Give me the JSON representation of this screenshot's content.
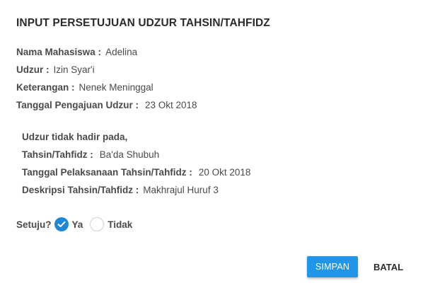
{
  "dialog": {
    "title": "INPUT PERSETUJUAN UDZUR TAHSIN/TAHFIDZ",
    "fields": {
      "nama_label": "Nama Mahasiswa :",
      "nama_value": "Adelina",
      "udzur_label": "Udzur :",
      "udzur_value": "Izin Syar'i",
      "keterangan_label": "Keterangan :",
      "keterangan_value": "Nenek Meninggal",
      "tanggal_pengajuan_label": "Tanggal Pengajuan Udzur :",
      "tanggal_pengajuan_value": "23 Okt 2018"
    },
    "absence": {
      "heading": "Udzur tidak hadir pada,",
      "tahsin_label": "Tahsin/Tahfidz :",
      "tahsin_value": "Ba'da Shubuh",
      "tanggal_label": "Tanggal Pelaksanaan Tahsin/Tahfidz :",
      "tanggal_value": "20 Okt 2018",
      "deskripsi_label": "Deskripsi Tahsin/Tahfidz :",
      "deskripsi_value": "Makhrajul Huruf 3"
    },
    "consent": {
      "question": "Setuju?",
      "yes_label": "Ya",
      "no_label": "Tidak",
      "selected": "Ya"
    },
    "buttons": {
      "save": "SIMPAN",
      "cancel": "BATAL"
    },
    "colors": {
      "primary": "#2196e8",
      "radio_checked": "#1e88d6"
    }
  }
}
